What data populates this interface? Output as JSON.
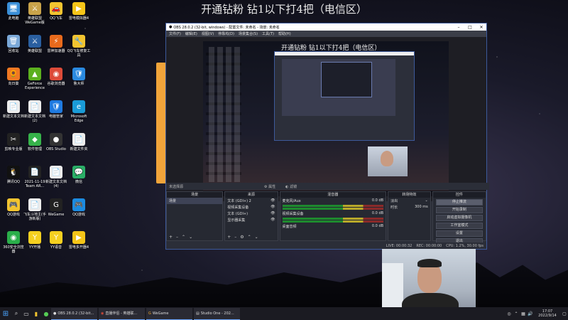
{
  "stream_title": "开通钻粉 钻1以下打4把（电信区）",
  "desktop_icons": [
    {
      "label": "此电脑",
      "color": "#3a8fd8",
      "glyph": "🖥"
    },
    {
      "label": "英雄联盟WeGame版",
      "color": "#c9a34a",
      "glyph": "⚔"
    },
    {
      "label": "QQ飞车",
      "color": "#f2c430",
      "glyph": "🚗"
    },
    {
      "label": "雷电模拟器4",
      "color": "#f5c518",
      "glyph": "▶"
    },
    {
      "label": "回收站",
      "color": "#7aa8d8",
      "glyph": "🗑"
    },
    {
      "label": "英雄联盟",
      "color": "#2a5fa0",
      "glyph": "⚔"
    },
    {
      "label": "雷神加速器",
      "color": "#e86a1c",
      "glyph": "⚡"
    },
    {
      "label": "QQ飞车修复工具",
      "color": "#f2c430",
      "glyph": "🔧"
    },
    {
      "label": "向日葵",
      "color": "#f07822",
      "glyph": "🌻"
    },
    {
      "label": "GeForce Experience",
      "color": "#5cb01e",
      "glyph": "▲"
    },
    {
      "label": "谷歌浏览器",
      "color": "#dd4b39",
      "glyph": "◉"
    },
    {
      "label": "鲁大师",
      "color": "#2a8ae0",
      "glyph": "🛡"
    },
    {
      "label": "新建文本文档",
      "color": "#ececec",
      "glyph": "📄"
    },
    {
      "label": "新建文本文档(2)",
      "color": "#ececec",
      "glyph": "📄"
    },
    {
      "label": "电脑管家",
      "color": "#1f7ae0",
      "glyph": "🛡"
    },
    {
      "label": "Microsoft Edge",
      "color": "#1a9bd7",
      "glyph": "e"
    },
    {
      "label": "剪映专业版",
      "color": "#222",
      "glyph": "✂"
    },
    {
      "label": "软件管理",
      "color": "#36b24a",
      "glyph": "◆"
    },
    {
      "label": "OBS Studio",
      "color": "#333",
      "glyph": "●"
    },
    {
      "label": "新建文件夹",
      "color": "#ececec",
      "glyph": "📄"
    },
    {
      "label": "腾讯QQ",
      "color": "#111",
      "glyph": "🐧"
    },
    {
      "label": "2021-11-19 Team AR...",
      "color": "#222",
      "glyph": "📄"
    },
    {
      "label": "新建文本文档(4)",
      "color": "#ececec",
      "glyph": "📄"
    },
    {
      "label": "微信",
      "color": "#2aae67",
      "glyph": "💬"
    },
    {
      "label": "QQ游戏",
      "color": "#f2c430",
      "glyph": "🎮"
    },
    {
      "label": "飞车斗地主(手游新版)",
      "color": "#ececec",
      "glyph": "📄"
    },
    {
      "label": "WeGame",
      "color": "#222",
      "glyph": "G"
    },
    {
      "label": "QQ游戏",
      "color": "#1c8be0",
      "glyph": "🎮"
    },
    {
      "label": "360安全浏览器",
      "color": "#2aae4a",
      "glyph": "◉"
    },
    {
      "label": "YY开播",
      "color": "#f5d020",
      "glyph": "Y"
    },
    {
      "label": "YY语音",
      "color": "#f5d020",
      "glyph": "Y"
    },
    {
      "label": "雷电多开器4",
      "color": "#f5c518",
      "glyph": "▶"
    }
  ],
  "obs": {
    "window_title": "OBS 28.0.2 (32-bit, windows) - 配置文件: 未命名 - 场景: 未命名",
    "menu": [
      "文件(F)",
      "编辑(E)",
      "视图(V)",
      "停靠坞(D)",
      "场景集合(S)",
      "工具(T)",
      "帮助(H)"
    ],
    "scene_title": "开通钻粉 钻1以下打4把（电信区）",
    "no_source": "未选择源",
    "filter_label": "滤镜",
    "attr_label": "属性",
    "docks": {
      "scenes": {
        "header": "场景",
        "items": [
          "场景"
        ]
      },
      "sources": {
        "header": "来源",
        "items": [
          "文本 (GDI+) 2",
          "视频采集设备",
          "文本 (GDI+)",
          "显示器采集"
        ]
      },
      "mixer": {
        "header": "混音器",
        "channels": [
          {
            "name": "麦克风/Aux",
            "value": "0.0 dB"
          },
          {
            "name": "视频采集设备",
            "value": "0.0 dB"
          },
          {
            "name": "桌面音频",
            "value": "0.0 dB"
          }
        ]
      },
      "transitions": {
        "header": "转场特效",
        "type": "淡出",
        "duration_label": "时长",
        "duration": "300 ms"
      },
      "controls": {
        "header": "控件",
        "buttons": [
          "停止推流",
          "开始录制",
          "启动虚拟摄像机",
          "工作室模式",
          "设置",
          "退出"
        ]
      }
    },
    "status": [
      "LIVE: 00:00:32",
      "REC: 00:00:00",
      "CPU: 1.2%, 30.00 fps"
    ]
  },
  "taskbar": {
    "apps": [
      "OBS 28.0.2 (32-bit...",
      "直播伴侣 - 英雄联...",
      "WeGame",
      "Studio One - 202..."
    ],
    "time": "17:07",
    "date": "2022/9/14"
  }
}
